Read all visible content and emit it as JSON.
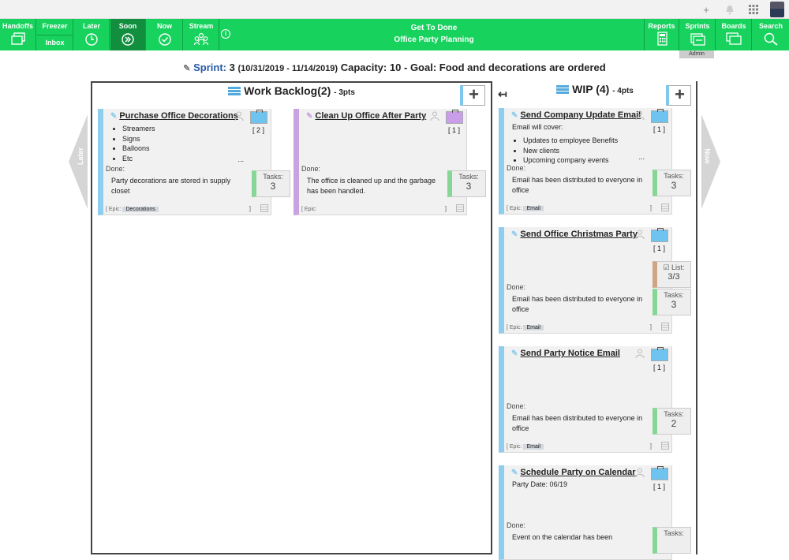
{
  "nav": {
    "handoffs": "Handoffs",
    "freezer": "Freezer",
    "inbox": "Inbox",
    "later": "Later",
    "soon": "Soon",
    "now": "Now",
    "stream": "Stream",
    "title1": "Get To Done",
    "title2": "Office Party Planning",
    "reports": "Reports",
    "sprints": "Sprints",
    "boards": "Boards",
    "search": "Search",
    "admin": "Admin",
    "accent": "#17d25d"
  },
  "sprint": {
    "label": "Sprint:",
    "number": "3",
    "dates": "(10/31/2019 - 11/14/2019)",
    "capacity_label": "Capacity:",
    "capacity": "10",
    "goal_label": "Goal:",
    "goal": "Food and decorations are ordered"
  },
  "side": {
    "left": "Later",
    "right": "Now"
  },
  "backlog": {
    "title": "Work Backlog(2)",
    "pts": "- 3pts",
    "cards": [
      {
        "title": "Purchase Office Decorations",
        "points": "[  2  ]",
        "bullets": [
          "Streamers",
          "Signs",
          "Balloons",
          "Etc"
        ],
        "more": "...",
        "done_label": "Done:",
        "done": "Party decorations are stored in supply closet",
        "tasks_label": "Tasks:",
        "tasks": "3",
        "epic_label": "[ Epic:",
        "epic": "Decorations",
        "close": "]"
      },
      {
        "title": "Clean Up Office After Party",
        "points": "[  1  ]",
        "done_label": "Done:",
        "done": "The office is cleaned up and the garbage has been handled.",
        "tasks_label": "Tasks:",
        "tasks": "3",
        "epic_label": "[ Epic:",
        "close": "]"
      }
    ]
  },
  "wip": {
    "title": "WIP (4)",
    "pts": "- 4pts",
    "cards": [
      {
        "title": "Send Company Update Email",
        "points": "[  1  ]",
        "desc": "Email will cover:",
        "bullets": [
          "Updates to employee Benefits",
          "New clients",
          "Upcoming company events"
        ],
        "more": "...",
        "done_label": "Done:",
        "done": "Email has been distributed to everyone in office",
        "tasks_label": "Tasks:",
        "tasks": "3",
        "epic_label": "[ Epic:",
        "epic": "Email",
        "close": "]"
      },
      {
        "title": "Send Office Christmas Party",
        "points": "[  1  ]",
        "list_label": "List:",
        "list": "3/3",
        "done_label": "Done:",
        "done": "Email has been distributed to everyone in office",
        "tasks_label": "Tasks:",
        "tasks": "3",
        "epic_label": "[ Epic:",
        "epic": "Email",
        "close": "]"
      },
      {
        "title": "Send Party Notice Email",
        "points": "[  1  ]",
        "done_label": "Done:",
        "done": "Email has been distributed to everyone in office",
        "tasks_label": "Tasks:",
        "tasks": "2",
        "epic_label": "[ Epic:",
        "epic": "Email",
        "close": "]"
      },
      {
        "title": "Schedule Party on Calendar",
        "points": "[  1  ]",
        "desc": "Party Date: 06/19",
        "done_label": "Done:",
        "done": "Event on the calendar has been",
        "tasks_label": "Tasks:"
      }
    ]
  }
}
